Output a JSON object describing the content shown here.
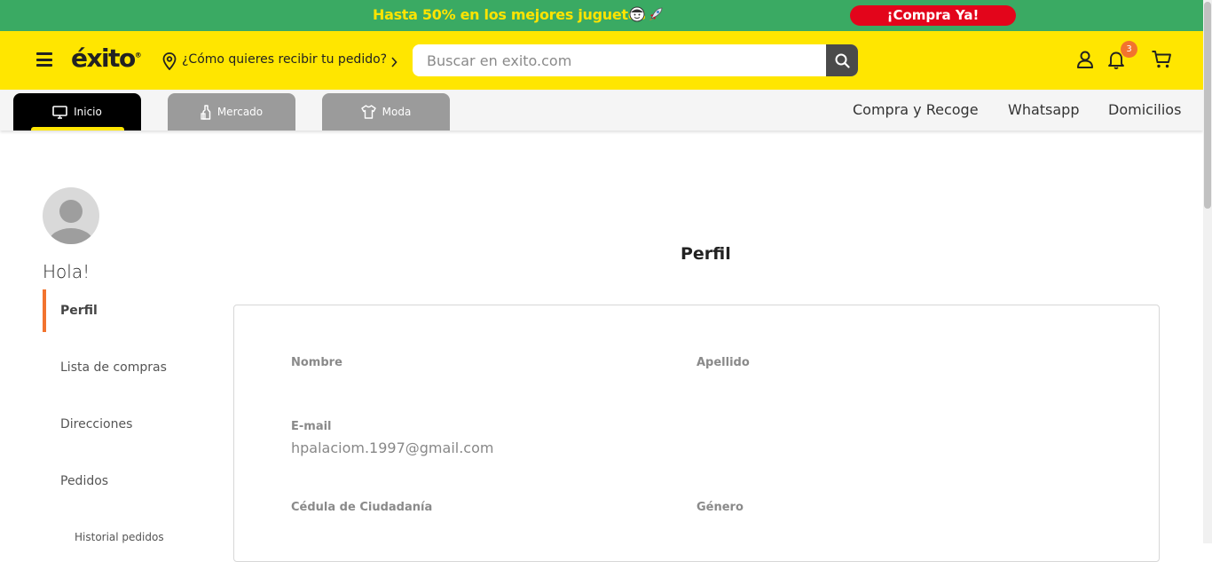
{
  "promo": {
    "text": "Hasta 50% en los mejores juguetes",
    "cta": "¡Compra Ya!"
  },
  "header": {
    "logo": "éxito",
    "delivery_prompt": "¿Cómo quieres recibir tu pedido?",
    "search_placeholder": "Buscar en exito.com",
    "notification_count": "3"
  },
  "nav": {
    "tabs": [
      {
        "label": "Inicio",
        "icon": "monitor-icon"
      },
      {
        "label": "Mercado",
        "icon": "bottle-icon"
      },
      {
        "label": "Moda",
        "icon": "shirt-icon"
      }
    ],
    "links": [
      "Compra y Recoge",
      "Whatsapp",
      "Domicilios"
    ]
  },
  "sidebar": {
    "greeting": "Hola!",
    "items": [
      {
        "label": "Perfil",
        "active": true
      },
      {
        "label": "Lista de compras"
      },
      {
        "label": "Direcciones"
      },
      {
        "label": "Pedidos"
      }
    ],
    "sub_items": [
      "Historial pedidos"
    ]
  },
  "profile": {
    "title": "Perfil",
    "fields": {
      "nombre": {
        "label": "Nombre",
        "value": ""
      },
      "apellido": {
        "label": "Apellido",
        "value": ""
      },
      "email": {
        "label": "E-mail",
        "value": "hpalaciom.1997@gmail.com"
      },
      "cedula": {
        "label": "Cédula de Ciudadanía",
        "value": ""
      },
      "genero": {
        "label": "Género",
        "value": ""
      }
    }
  },
  "colors": {
    "promo_bg": "#3aaa63",
    "promo_text": "#ffe400",
    "header_bg": "#ffe600",
    "cta_red": "#e3051b",
    "accent_orange": "#f2732e"
  }
}
